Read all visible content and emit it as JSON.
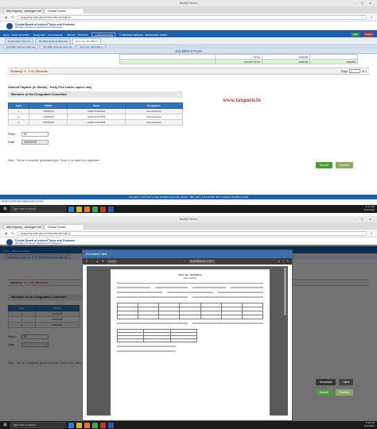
{
  "top": {
    "window_title": "Mozilla Firefox",
    "tabs": [
      "http://appexy...cexangen.ear",
      "Central Excise"
    ],
    "url": "aceproxy.cbec.gov.in/cbec/sllr-ver.sqli.sc",
    "app": {
      "board": "Central Board of Indirect Taxes and Customs",
      "ministry": "Ministry of Finance, Department of Revenue"
    },
    "userbar": {
      "name": "Name : ACES TestUSR1",
      "designation": "Designation : Commissioner",
      "ssoid": "SSO ID : 27001234",
      "badge": "COMMISSIONER",
      "location": "COMMISSIONERATE : DEMO/ACES ADMIN",
      "help": "Help",
      "logout": "Logout"
    },
    "page_tabs": [
      "Registration Task List",
      "SVLDRS Scheme Task List",
      "Form No. SVLDRS-3"
    ],
    "sub_tabs": [
      "SVLDRS Scheme Task List",
      "SVLDRS Scheme Task List",
      "Form No. SVLDRS-3"
    ],
    "form_header": "SVLDRS-3 Form",
    "totals": {
      "label1": "TOTAL",
      "value1": "4000000",
      "label2": "GRAND TOTAL",
      "value2": "4000000",
      "value3": "4000000"
    },
    "showing": "Showing : 1 - 1 of 1 Records",
    "page_label": "Page",
    "page_value": "1",
    "page_of": "of 1",
    "amount": "Amount Payable (in Words) : Forty Five Lakhs rupees only",
    "watermark": "www.taxguru.in",
    "members_title": "Members of the Designated Committee",
    "members_headers": [
      "S.No.",
      "SSOID",
      "Name",
      "Designation"
    ],
    "members_rows": [
      [
        "1",
        "27001234",
        "ACES TestUSR1",
        "Commissioner"
      ],
      [
        "2",
        "27001235",
        "ACES TestUSR2",
        "Commissioner"
      ],
      [
        "3",
        "27001236",
        "ACES TestUSR3",
        "Commissioner"
      ]
    ],
    "place_label": "Place :",
    "place_value": "DF",
    "date_label": "Date :",
    "date_value": "20/09/2019",
    "submit": "Submit",
    "preview": "Preview",
    "note": "Note : This is a computer generated print. There is no need for a signature.",
    "footer": "Copyright © 2017 Govt of India All Rights Reserved. Version: CBIC_2017_1.0.4 dd-29th 2017 (Indicates mandatory fields)",
    "status_url": "aceproxy.cbec.gov.in/ace-annex-ver.ovi"
  },
  "bottom": {
    "window_title": "Mozilla Firefox",
    "tabs": [
      "http://appexy...cexangen.ear",
      "Central Excise"
    ],
    "url": "aceproxy.cbec.gov.in/cbec/sllr-ver.sqli.sc",
    "userbar_name": "Name : ACES TestUSR1",
    "showing": "Showing : 1 - 1 of 1 Records",
    "members_title": "Members of the Designated Committee",
    "members_headers": [
      "S.No.",
      "SSOID"
    ],
    "members_rows": [
      [
        "1",
        "27001234"
      ],
      [
        "2",
        "27001235"
      ],
      [
        "3",
        "27001236"
      ]
    ],
    "place_label": "Place :",
    "place_value": "DF",
    "date_label": "Date :",
    "download": "Download",
    "view": "View",
    "submit": "Submit",
    "preview": "Preview",
    "note": "Note : This is a computer generated print. There is no need for a signature.",
    "modal": {
      "title": "Document View",
      "page_indicator": "1 of 2",
      "copy_label": "SUPERSEDE COPY",
      "pdf_title": "Form No. SVLDRS-3",
      "pdf_subtitle": "[See rule 6(1)]"
    }
  },
  "taskbar": {
    "search": "Type here to search",
    "time1": "5:17 PM",
    "date1": "9/12/2019",
    "time2": "5:18 PM",
    "date2": "9/12/2019"
  }
}
